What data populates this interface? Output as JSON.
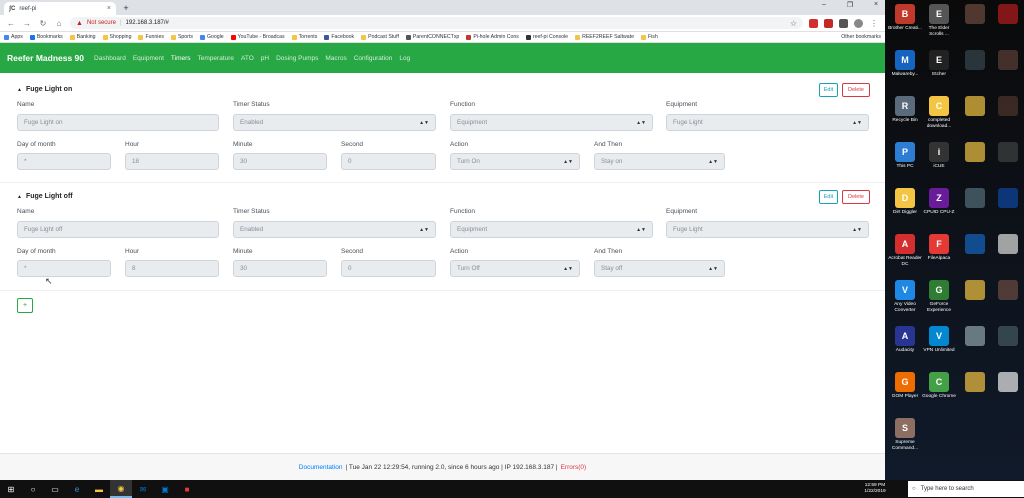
{
  "browser": {
    "tab_title": "reef-pi",
    "tab_favicon": "ʃC",
    "new_tab": "+",
    "close_tab": "×",
    "window_controls": [
      "–",
      "❐",
      "×"
    ],
    "not_secure": "Not secure",
    "url": "192.168.3.187/#",
    "bookmarks": [
      {
        "label": "Apps",
        "color": "#4285f4"
      },
      {
        "label": "Bookmarks",
        "color": "#1a73e8"
      },
      {
        "label": "Banking",
        "color": "#f4c542"
      },
      {
        "label": "Shopping",
        "color": "#f4c542"
      },
      {
        "label": "Funnies",
        "color": "#f4c542"
      },
      {
        "label": "Sports",
        "color": "#f4c542"
      },
      {
        "label": "Google",
        "color": "#4285f4"
      },
      {
        "label": "YouTube - Broadcas",
        "color": "#ff0000"
      },
      {
        "label": "Torrents",
        "color": "#f4c542"
      },
      {
        "label": "Facebook",
        "color": "#3b5998"
      },
      {
        "label": "Podcast Stuff",
        "color": "#f4c542"
      },
      {
        "label": "ParentCONNECTxp",
        "color": "#555555"
      },
      {
        "label": "Pi-hole Admin Cons",
        "color": "#c0392b"
      },
      {
        "label": "reef-pi Console",
        "color": "#333333"
      },
      {
        "label": "REEF2REEF Saltwate",
        "color": "#f4c542"
      },
      {
        "label": "Fish",
        "color": "#f4c542"
      }
    ],
    "other_bookmarks": "Other bookmarks"
  },
  "app": {
    "brand": "Reefer Madness 90",
    "nav": [
      "Dashboard",
      "Equipment",
      "Timers",
      "Temperature",
      "ATO",
      "pH",
      "Dosing Pumps",
      "Macros",
      "Configuration",
      "Log"
    ],
    "active_nav": "Timers"
  },
  "labels": {
    "name": "Name",
    "timer_status": "Timer Status",
    "function": "Function",
    "equipment": "Equipment",
    "day_of_month": "Day of month",
    "hour": "Hour",
    "minute": "Minute",
    "second": "Second",
    "action": "Action",
    "and_then": "And Then",
    "edit": "Edit",
    "delete": "Delete",
    "add": "+"
  },
  "timers": [
    {
      "title": "Fuge Light on",
      "name": "Fuge Light on",
      "status": "Enabled",
      "function": "Equipment",
      "equipment": "Fuge Light",
      "day_of_month": "*",
      "hour": "18",
      "minute": "30",
      "second": "0",
      "action": "Turn On",
      "and_then": "Stay on"
    },
    {
      "title": "Fuge Light off",
      "name": "Fuge Light off",
      "status": "Enabled",
      "function": "Equipment",
      "equipment": "Fuge Light",
      "day_of_month": "*",
      "hour": "8",
      "minute": "30",
      "second": "0",
      "action": "Turn Off",
      "and_then": "Stay off"
    }
  ],
  "footer": {
    "documentation": "Documentation",
    "status": "| Tue Jan 22 12:29:54, running 2.0, since 6 hours ago | IP 192.168.3.187 |",
    "errors": "Errors(0)"
  },
  "desktop_icons": [
    {
      "label": "Brother Creati...",
      "color": "#c0392b",
      "glyph": "B"
    },
    {
      "label": "The Elder Scrolls ...",
      "color": "#555555",
      "glyph": "E"
    },
    {
      "label": "Malwareby...",
      "color": "#1565c0",
      "glyph": "M"
    },
    {
      "label": "Etcher",
      "color": "#222222",
      "glyph": "E"
    },
    {
      "label": "Recycle Bin",
      "color": "#5a6b7c",
      "glyph": "R"
    },
    {
      "label": "completed download...",
      "color": "#f4c542",
      "glyph": "C"
    },
    {
      "label": "This PC",
      "color": "#2d7dd2",
      "glyph": "P"
    },
    {
      "label": "iCUE",
      "color": "#333333",
      "glyph": "i"
    },
    {
      "label": "Dirt Diggler",
      "color": "#f4c542",
      "glyph": "D"
    },
    {
      "label": "CPUID CPU-Z",
      "color": "#6a1b9a",
      "glyph": "Z"
    },
    {
      "label": "Acrobat Reader DC",
      "color": "#d32f2f",
      "glyph": "A"
    },
    {
      "label": "FileAlpaca",
      "color": "#e53935",
      "glyph": "F"
    },
    {
      "label": "Any Video Converter",
      "color": "#1e88e5",
      "glyph": "V"
    },
    {
      "label": "GeForce Experience",
      "color": "#2e7d32",
      "glyph": "G"
    },
    {
      "label": "Audacity",
      "color": "#283593",
      "glyph": "A"
    },
    {
      "label": "VPN Unlimited",
      "color": "#0288d1",
      "glyph": "V"
    },
    {
      "label": "GOM Player",
      "color": "#ef6c00",
      "glyph": "G"
    },
    {
      "label": "Google Chrome",
      "color": "#43a047",
      "glyph": "C"
    },
    {
      "label": "Supreme Command...",
      "color": "#8d6e63",
      "glyph": "S"
    }
  ],
  "taskbar": {
    "search_placeholder": "Type here to search",
    "time": "12:59 PM",
    "date": "1/22/2019"
  }
}
